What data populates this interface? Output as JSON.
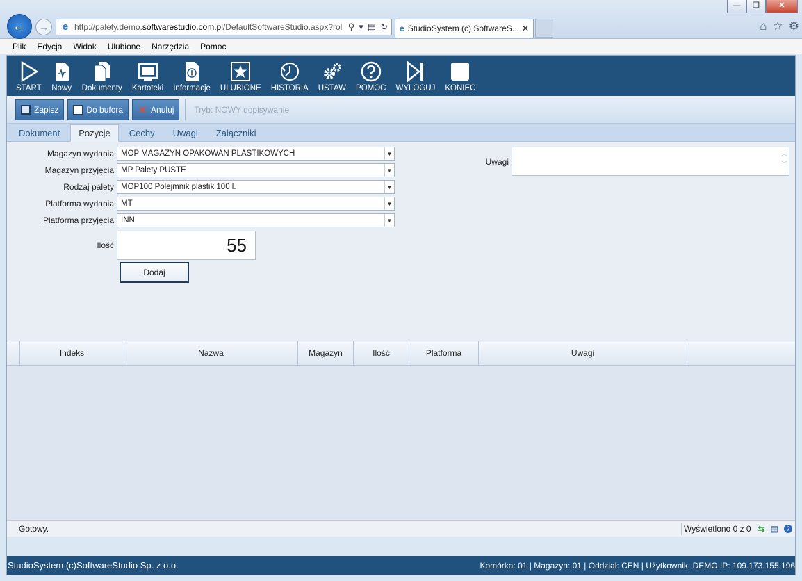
{
  "browser": {
    "address_prefix": "http://palety.demo.",
    "address_domain": "softwarestudio.com.pl",
    "address_path": "/DefaultSoftwareStudio.aspx?rol",
    "tab_title": "StudioSystem (c) SoftwareS...",
    "tab_close": "✕",
    "win_minimize": "—",
    "win_restore": "❐",
    "win_close": "✕"
  },
  "menu": [
    "Plik",
    "Edycja",
    "Widok",
    "Ulubione",
    "Narzędzia",
    "Pomoc"
  ],
  "app_toolbar": [
    {
      "label": "START",
      "icon": "play-icon"
    },
    {
      "label": "Nowy",
      "icon": "new-document-icon"
    },
    {
      "label": "Dokumenty",
      "icon": "documents-icon"
    },
    {
      "label": "Kartoteki",
      "icon": "monitor-icon"
    },
    {
      "label": "Informacje",
      "icon": "info-icon"
    },
    {
      "label": "ULUBIONE",
      "icon": "star-icon"
    },
    {
      "label": "HISTORIA",
      "icon": "history-icon"
    },
    {
      "label": "USTAW",
      "icon": "gears-icon"
    },
    {
      "label": "POMOC",
      "icon": "help-icon"
    },
    {
      "label": "WYLOGUJ",
      "icon": "logout-icon"
    },
    {
      "label": "KONIEC",
      "icon": "stop-icon"
    }
  ],
  "actions": {
    "save": "Zapisz",
    "buffer": "Do bufora",
    "cancel": "Anuluj",
    "mode": "Tryb: NOWY dopisywanie"
  },
  "tabs": [
    "Dokument",
    "Pozycje",
    "Cechy",
    "Uwagi",
    "Załączniki"
  ],
  "active_tab": "Pozycje",
  "form": {
    "magazyn_wydania": {
      "label": "Magazyn wydania",
      "value": "MOP MAGAZYN OPAKOWAŃ PLASTIKOWYCH"
    },
    "magazyn_przyjecia": {
      "label": "Magazyn przyjęcia",
      "value": "MP Palety PUSTE"
    },
    "rodzaj_palety": {
      "label": "Rodzaj palety",
      "value": "MOP100 Polejmnik plastik 100 l."
    },
    "platforma_wydania": {
      "label": "Platforma wydania",
      "value": "MT"
    },
    "platforma_przyjecia": {
      "label": "Platforma przyjęcia",
      "value": "INN"
    },
    "ilosc": {
      "label": "Ilość",
      "value": "55"
    },
    "add_button": "Dodaj",
    "uwagi_label": "Uwagi",
    "uwagi_value": ""
  },
  "grid": {
    "columns": [
      "Indeks",
      "Nazwa",
      "Magazyn",
      "Ilość",
      "Platforma",
      "Uwagi"
    ],
    "rows": []
  },
  "status": {
    "text": "Gotowy.",
    "displayed": "Wyświetlono 0 z 0"
  },
  "footer": {
    "left": "StudioSystem (c)SoftwareStudio Sp. z o.o.",
    "right": "Komórka: 01 | Magazyn: 01 | Oddział: CEN | Użytkownik: DEMO IP: 109.173.155.196"
  }
}
